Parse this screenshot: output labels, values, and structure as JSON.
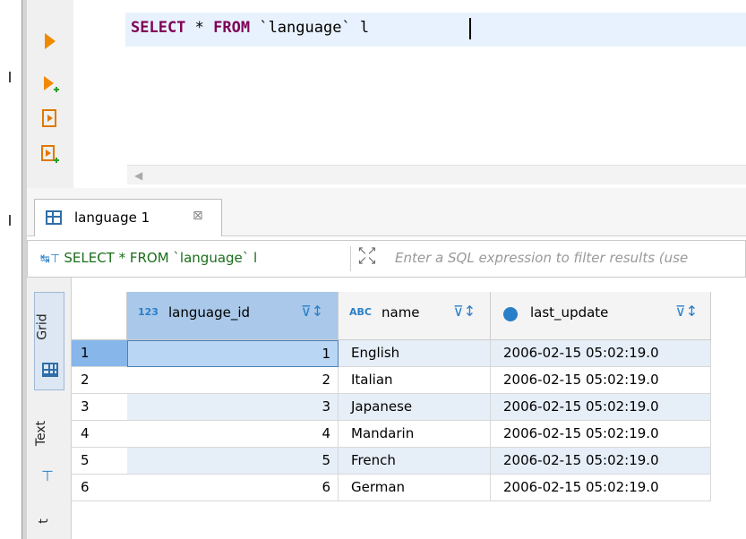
{
  "editor": {
    "sql_keyword_select": "SELECT",
    "sql_star": " * ",
    "sql_keyword_from": "FROM",
    "sql_table": " `language` l "
  },
  "tab": {
    "label": "language 1",
    "close": "⊠"
  },
  "filter": {
    "query": "SELECT * FROM `language` l",
    "placeholder": "Enter a SQL expression to filter results (use"
  },
  "side_panel": {
    "grid_label": "Grid",
    "text_label": "Text",
    "extra_label": "t"
  },
  "columns": [
    {
      "name": "language_id",
      "type_icon": "123"
    },
    {
      "name": "name",
      "type_icon": "ABC"
    },
    {
      "name": "last_update",
      "type_icon": "clock"
    }
  ],
  "rows": [
    {
      "num": "1",
      "id": "1",
      "name": "English",
      "last_update": "2006-02-15 05:02:19.0"
    },
    {
      "num": "2",
      "id": "2",
      "name": "Italian",
      "last_update": "2006-02-15 05:02:19.0"
    },
    {
      "num": "3",
      "id": "3",
      "name": "Japanese",
      "last_update": "2006-02-15 05:02:19.0"
    },
    {
      "num": "4",
      "id": "4",
      "name": "Mandarin",
      "last_update": "2006-02-15 05:02:19.0"
    },
    {
      "num": "5",
      "id": "5",
      "name": "French",
      "last_update": "2006-02-15 05:02:19.0"
    },
    {
      "num": "6",
      "id": "6",
      "name": "German",
      "last_update": "2006-02-15 05:02:19.0"
    }
  ],
  "colors": {
    "keyword": "#7f0055",
    "selected_header": "#a9c8ea",
    "selected_row": "#86b6ea",
    "accent": "#2a7fc9"
  }
}
